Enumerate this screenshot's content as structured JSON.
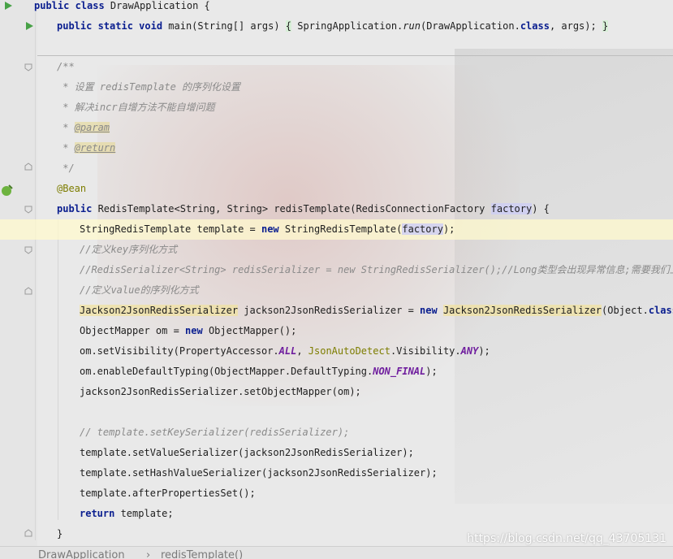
{
  "lines": [
    {
      "segments": [
        {
          "t": "public class ",
          "c": "kw"
        },
        {
          "t": "DrawApplication {"
        }
      ]
    },
    {
      "segments": [
        {
          "t": "public static void ",
          "c": "kw"
        },
        {
          "t": "main(String[] args) "
        },
        {
          "t": "{",
          "c": "hl-brace"
        },
        {
          "t": " SpringApplication."
        },
        {
          "t": "run",
          "c": "ital"
        },
        {
          "t": "(DrawApplication."
        },
        {
          "t": "class",
          "c": "kw"
        },
        {
          "t": ", args); "
        },
        {
          "t": "}",
          "c": "hl-brace"
        }
      ]
    },
    {
      "segments": [
        {
          "t": "/**",
          "c": "cm"
        }
      ]
    },
    {
      "segments": [
        {
          "t": " * 设置 redisTemplate 的序列化设置",
          "c": "cm"
        }
      ]
    },
    {
      "segments": [
        {
          "t": " * 解决incr自增方法不能自增问题",
          "c": "cm"
        }
      ]
    },
    {
      "segments": [
        {
          "t": " * ",
          "c": "cm"
        },
        {
          "t": "@param",
          "c": "jdoc"
        }
      ]
    },
    {
      "segments": [
        {
          "t": " * ",
          "c": "cm"
        },
        {
          "t": "@return",
          "c": "jdoc"
        }
      ]
    },
    {
      "segments": [
        {
          "t": " */",
          "c": "cm"
        }
      ]
    },
    {
      "segments": [
        {
          "t": "@Bean",
          "c": "ann"
        }
      ]
    },
    {
      "segments": [
        {
          "t": "public ",
          "c": "kw"
        },
        {
          "t": "RedisTemplate<String, String> redisTemplate(RedisConnectionFactory "
        },
        {
          "t": "factory",
          "c": "hl-param"
        },
        {
          "t": ") {"
        }
      ]
    },
    {
      "segments": [
        {
          "t": "StringRedisTemplate template = "
        },
        {
          "t": "new ",
          "c": "kw"
        },
        {
          "t": "StringRedisTemplate("
        },
        {
          "t": "factory",
          "c": "hl-param"
        },
        {
          "t": ");"
        }
      ]
    },
    {
      "segments": [
        {
          "t": "//定义key序列化方式",
          "c": "cm"
        }
      ]
    },
    {
      "segments": [
        {
          "t": "//RedisSerializer<String> redisSerializer = new StringRedisSerializer();//Long类型会出现异常信息;需要我们上",
          "c": "cm"
        }
      ]
    },
    {
      "segments": [
        {
          "t": "//定义value的序列化方式",
          "c": "cm"
        }
      ]
    },
    {
      "segments": [
        {
          "t": "Jackson2JsonRedisSerializer",
          "c": "hl-warn"
        },
        {
          "t": " jackson2JsonRedisSerializer = "
        },
        {
          "t": "new ",
          "c": "kw"
        },
        {
          "t": "Jackson2JsonRedisSerializer",
          "c": "hl-warn"
        },
        {
          "t": "(Object."
        },
        {
          "t": "class",
          "c": "kw"
        },
        {
          "t": ");"
        }
      ]
    },
    {
      "segments": [
        {
          "t": "ObjectMapper om = "
        },
        {
          "t": "new ",
          "c": "kw"
        },
        {
          "t": "ObjectMapper();"
        }
      ]
    },
    {
      "segments": [
        {
          "t": "om.setVisibility(PropertyAccessor."
        },
        {
          "t": "ALL",
          "c": "const"
        },
        {
          "t": ", "
        },
        {
          "t": "JsonAutoDetect",
          "c": "olive"
        },
        {
          "t": ".Visibility."
        },
        {
          "t": "ANY",
          "c": "const"
        },
        {
          "t": ");"
        }
      ]
    },
    {
      "segments": [
        {
          "t": "om.enableDefaultTyping(ObjectMapper.DefaultTyping."
        },
        {
          "t": "NON_FINAL",
          "c": "const"
        },
        {
          "t": ");"
        }
      ]
    },
    {
      "segments": [
        {
          "t": "jackson2JsonRedisSerializer.setObjectMapper(om);"
        }
      ]
    },
    {
      "segments": [
        {
          "t": "// template.setKeySerializer(redisSerializer);",
          "c": "cm"
        }
      ]
    },
    {
      "segments": [
        {
          "t": "template.setValueSerializer(jackson2JsonRedisSerializer);"
        }
      ]
    },
    {
      "segments": [
        {
          "t": "template.setHashValueSerializer(jackson2JsonRedisSerializer);"
        }
      ]
    },
    {
      "segments": [
        {
          "t": "template.afterPropertiesSet();"
        }
      ]
    },
    {
      "segments": [
        {
          "t": "return ",
          "c": "kw"
        },
        {
          "t": "template;"
        }
      ]
    },
    {
      "segments": [
        {
          "t": "}"
        }
      ]
    }
  ],
  "breadcrumb": {
    "class_name": "DrawApplication",
    "separator": "›",
    "method_name": "redisTemplate()"
  },
  "watermark": "https://blog.csdn.net/qq_43705131",
  "icons": {
    "run_main": "run-icon",
    "run_class": "run-icon",
    "bean_gutter": "spring-bean-icon",
    "fold_markers": "fold-icon"
  },
  "colors": {
    "keyword": "#0a1e8f",
    "comment": "#8a8a8a",
    "annotation": "#7d7d00",
    "constant": "#6f1e9e",
    "current_line": "#fffacd"
  }
}
